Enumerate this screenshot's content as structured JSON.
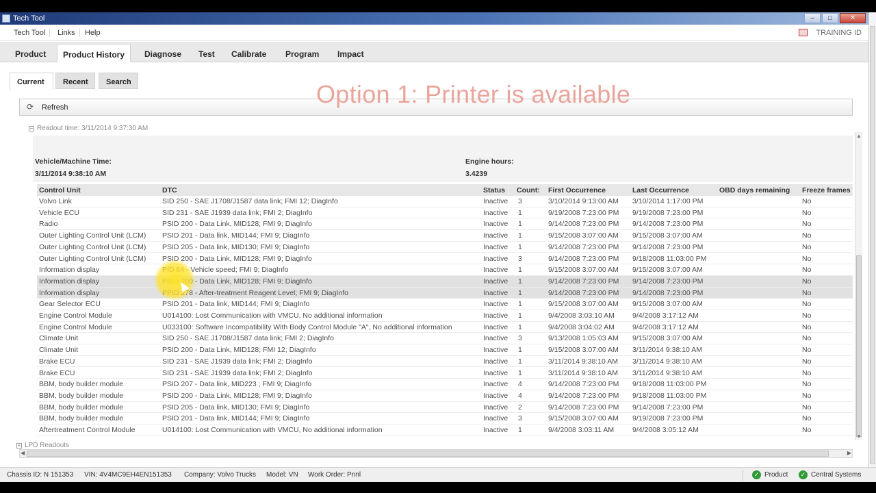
{
  "window": {
    "title": "Tech Tool",
    "controls": [
      "–",
      "□",
      "✕"
    ]
  },
  "menu": {
    "items": [
      "Tech Tool",
      "Links",
      "Help"
    ],
    "training": "TRAINING ID"
  },
  "nav": {
    "tabs": [
      "Product",
      "Product History",
      "Diagnose",
      "Test",
      "Calibrate",
      "Program",
      "Impact"
    ],
    "active": "Product History"
  },
  "subtabs": {
    "items": [
      "Current",
      "Recent",
      "Search"
    ],
    "active": "Current"
  },
  "overlay_text": "Option 1: Printer is available",
  "toolbar": {
    "refresh": "Refresh"
  },
  "readout": {
    "header": "Readout time: 3/11/2014 9:37:30 AM",
    "vehicle_time_label": "Vehicle/Machine Time:",
    "vehicle_time_value": "3/11/2014 9:38:10 AM",
    "engine_hours_label": "Engine hours:",
    "engine_hours_value": "3.4239"
  },
  "table": {
    "headers": [
      "Control Unit",
      "DTC",
      "Status",
      "Count:",
      "First Occurrence",
      "Last Occurrence",
      "OBD days remaining",
      "Freeze frames"
    ],
    "rows": [
      [
        "Volvo Link",
        "SID 250 - SAE J1708/J1587 data link; FMI 12; DiagInfo",
        "Inactive",
        "3",
        "3/10/2014 9:13:00 AM",
        "3/10/2014 1:17:00 PM",
        "",
        "No"
      ],
      [
        "Vehicle ECU",
        "SID 231 - SAE J1939 data link; FMI 2; DiagInfo",
        "Inactive",
        "1",
        "9/19/2008 7:23:00 PM",
        "9/19/2008 7:23:00 PM",
        "",
        "No"
      ],
      [
        "Radio",
        "PSID 200 - Data Link, MID128; FMI 9; DiagInfo",
        "Inactive",
        "1",
        "9/14/2008 7:23:00 PM",
        "9/14/2008 7:23:00 PM",
        "",
        "No"
      ],
      [
        "Outer Lighting Control Unit (LCM)",
        "PSID 201 - Data link, MID144; FMI 9; DiagInfo",
        "Inactive",
        "1",
        "9/15/2008 3:07:00 AM",
        "9/15/2008 3:07:00 AM",
        "",
        "No"
      ],
      [
        "Outer Lighting Control Unit (LCM)",
        "PSID 205 - Data link, MID130; FMI 9; DiagInfo",
        "Inactive",
        "1",
        "9/14/2008 7:23:00 PM",
        "9/14/2008 7:23:00 PM",
        "",
        "No"
      ],
      [
        "Outer Lighting Control Unit (LCM)",
        "PSID 200 - Data Link, MID128; FMI 9; DiagInfo",
        "Inactive",
        "3",
        "9/14/2008 7:23:00 PM",
        "9/18/2008 11:03:00 PM",
        "",
        "No"
      ],
      [
        "Information display",
        "PID 84 - Vehicle speed; FMI 9; DiagInfo",
        "Inactive",
        "1",
        "9/15/2008 3:07:00 AM",
        "9/15/2008 3:07:00 AM",
        "",
        "No"
      ],
      [
        "Information display",
        "PSID 200 - Data Link, MID128; FMI 9; DiagInfo",
        "Inactive",
        "1",
        "9/14/2008 7:23:00 PM",
        "9/14/2008 7:23:00 PM",
        "",
        "No"
      ],
      [
        "Information display",
        "PPID 278 - After-treatment Reagent Level; FMI 9; DiagInfo",
        "Inactive",
        "1",
        "9/14/2008 7:23:00 PM",
        "9/14/2008 7:23:00 PM",
        "",
        "No"
      ],
      [
        "Gear Selector ECU",
        "PSID 201 - Data link, MID144; FMI 9; DiagInfo",
        "Inactive",
        "1",
        "9/15/2008 3:07:00 AM",
        "9/15/2008 3:07:00 AM",
        "",
        "No"
      ],
      [
        "Engine Control Module",
        "U014100: Lost Communication with VMCU, No additional information",
        "Inactive",
        "1",
        "9/4/2008 3:03:10 AM",
        "9/4/2008 3:17:12 AM",
        "",
        "No"
      ],
      [
        "Engine Control Module",
        "U033100: Software Incompatibility With Body Control Module \"A\", No additional information",
        "Inactive",
        "1",
        "9/4/2008 3:04:02 AM",
        "9/4/2008 3:17:12 AM",
        "",
        "No"
      ],
      [
        "Climate Unit",
        "SID 250 - SAE J1708/J1587 data link; FMI 2; DiagInfo",
        "Inactive",
        "3",
        "9/13/2008 1:05:03 AM",
        "9/15/2008 3:07:00 AM",
        "",
        "No"
      ],
      [
        "Climate Unit",
        "PSID 200 - Data Link, MID128; FMI 12; DiagInfo",
        "Inactive",
        "1",
        "9/15/2008 3:07:00 AM",
        "3/11/2014 9:38:10 AM",
        "",
        "No"
      ],
      [
        "Brake ECU",
        "SID 231 - SAE J1939 data link; FMI 2; DiagInfo",
        "Inactive",
        "1",
        "3/11/2014 9:38:10 AM",
        "3/11/2014 9:38:10 AM",
        "",
        "No"
      ],
      [
        "Brake ECU",
        "SID 231 - SAE J1939 data link; FMI 2; DiagInfo",
        "Inactive",
        "1",
        "3/11/2014 9:38:10 AM",
        "3/11/2014 9:38:10 AM",
        "",
        "No"
      ],
      [
        "BBM, body builder module",
        "PSID 207 - Data link, MID223 ; FMI 9; DiagInfo",
        "Inactive",
        "4",
        "9/14/2008 7:23:00 PM",
        "9/18/2008 11:03:00 PM",
        "",
        "No"
      ],
      [
        "BBM, body builder module",
        "PSID 200 - Data Link, MID128; FMI 9; DiagInfo",
        "Inactive",
        "4",
        "9/14/2008 7:23:00 PM",
        "9/18/2008 11:03:00 PM",
        "",
        "No"
      ],
      [
        "BBM, body builder module",
        "PSID 205 - Data link, MID130; FMI 9; DiagInfo",
        "Inactive",
        "2",
        "9/14/2008 7:23:00 PM",
        "9/14/2008 7:23:00 PM",
        "",
        "No"
      ],
      [
        "BBM, body builder module",
        "PSID 201 - Data link, MID144; FMI 9; DiagInfo",
        "Inactive",
        "3",
        "9/15/2008 3:07:00 AM",
        "9/19/2008 7:23:00 PM",
        "",
        "No"
      ],
      [
        "Aftertreatment Control Module",
        "U014100: Lost Communication with VMCU, No additional information",
        "Inactive",
        "1",
        "9/4/2008 3:03:11 AM",
        "9/4/2008 3:05:12 AM",
        "",
        "No"
      ]
    ],
    "selected_rows": [
      7,
      8
    ]
  },
  "lpd": {
    "label": "LPD Readouts"
  },
  "status": {
    "chassis": "Chassis ID: N 151353",
    "vin": "VIN: 4V4MC9EH4EN151353",
    "company": "Company: Volvo Trucks",
    "model": "Model: VN",
    "work_order": "Work Order: Pnnl",
    "product": "Product",
    "central": "Central Systems"
  }
}
